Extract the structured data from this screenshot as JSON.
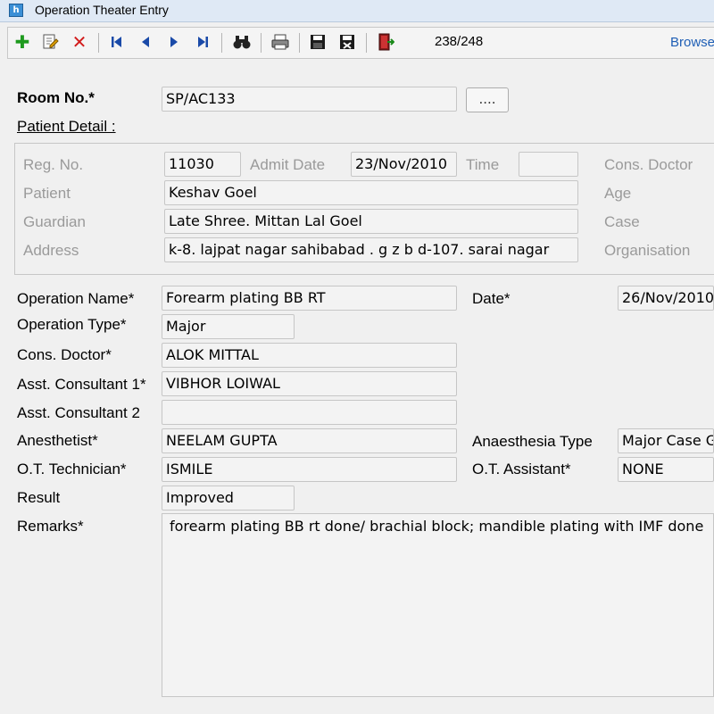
{
  "window": {
    "title": "Operation Theater Entry",
    "icon_letter": "h"
  },
  "toolbar": {
    "icons": [
      "add-icon",
      "edit-icon",
      "delete-icon",
      "first-record-icon",
      "previous-record-icon",
      "next-record-icon",
      "last-record-icon",
      "find-icon",
      "print-icon",
      "save-icon",
      "save-close-icon",
      "exit-icon"
    ],
    "counter": "238/248",
    "browse_label": "Browse"
  },
  "room": {
    "label": "Room No.*",
    "value": "SP/AC133",
    "lookup_button": "...."
  },
  "patient_detail": {
    "heading": "Patient Detail :",
    "reg_no_label": "Reg. No.",
    "reg_no": "11030",
    "admit_date_label": "Admit Date",
    "admit_date": "23/Nov/2010",
    "time_label": "Time",
    "time": "",
    "cons_doctor_label": "Cons. Doctor",
    "patient_label": "Patient",
    "patient": "Keshav Goel",
    "age_label": "Age",
    "guardian_label": "Guardian",
    "guardian": "Late Shree. Mittan Lal Goel",
    "case_label": "Case",
    "address_label": "Address",
    "address": "k-8. lajpat nagar sahibabad . g z b  d-107. sarai nagar",
    "organisation_label": "Organisation"
  },
  "operation": {
    "name_label": "Operation Name*",
    "name": "Forearm plating BB RT",
    "date_label": "Date*",
    "date": "26/Nov/2010",
    "type_label": "Operation Type*",
    "type": "Major",
    "cons_doctor_label": "Cons. Doctor*",
    "cons_doctor": "ALOK MITTAL",
    "asst1_label": "Asst. Consultant 1*",
    "asst1": "VIBHOR LOIWAL",
    "asst2_label": "Asst. Consultant 2",
    "asst2": "",
    "anesthetist_label": "Anesthetist*",
    "anesthetist": "NEELAM GUPTA",
    "anaesthesia_type_label": "Anaesthesia Type",
    "anaesthesia_type": "Major Case GA",
    "ot_technician_label": "O.T. Technician*",
    "ot_technician": "ISMILE",
    "ot_assistant_label": "O.T. Assistant*",
    "ot_assistant": "NONE",
    "result_label": "Result",
    "result": "Improved",
    "remarks_label": "Remarks*",
    "remarks": "forearm plating BB rt done/ brachial block; mandible plating with IMF done"
  }
}
